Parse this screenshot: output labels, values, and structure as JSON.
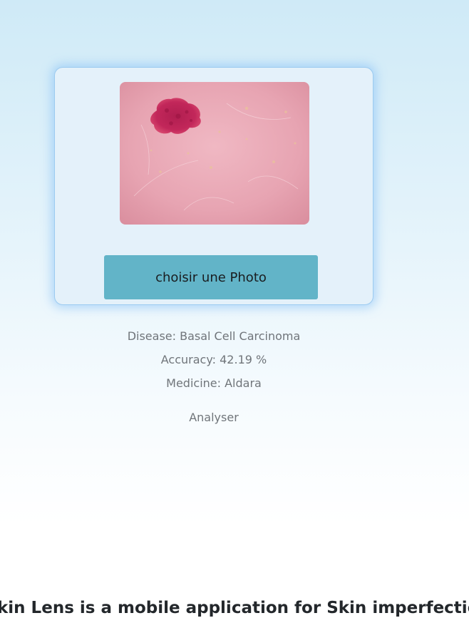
{
  "upload": {
    "photo_alt": "skin lesion photo",
    "choose_button_label": "choisir une Photo"
  },
  "results": {
    "disease": "Disease: Basal Cell Carcinoma",
    "accuracy": "Accuracy: 42.19 %",
    "medicine": "Medicine: Aldara"
  },
  "actions": {
    "analyse_label": "Analyser"
  },
  "footer": {
    "headline": "kin Lens is a mobile application for Skin imperfection"
  },
  "colors": {
    "button_bg": "#62b4c8",
    "card_border": "#9ccbf0",
    "card_bg": "#e4f1fa",
    "lesion": "#c2275a",
    "skin": "#e7a4b2"
  }
}
